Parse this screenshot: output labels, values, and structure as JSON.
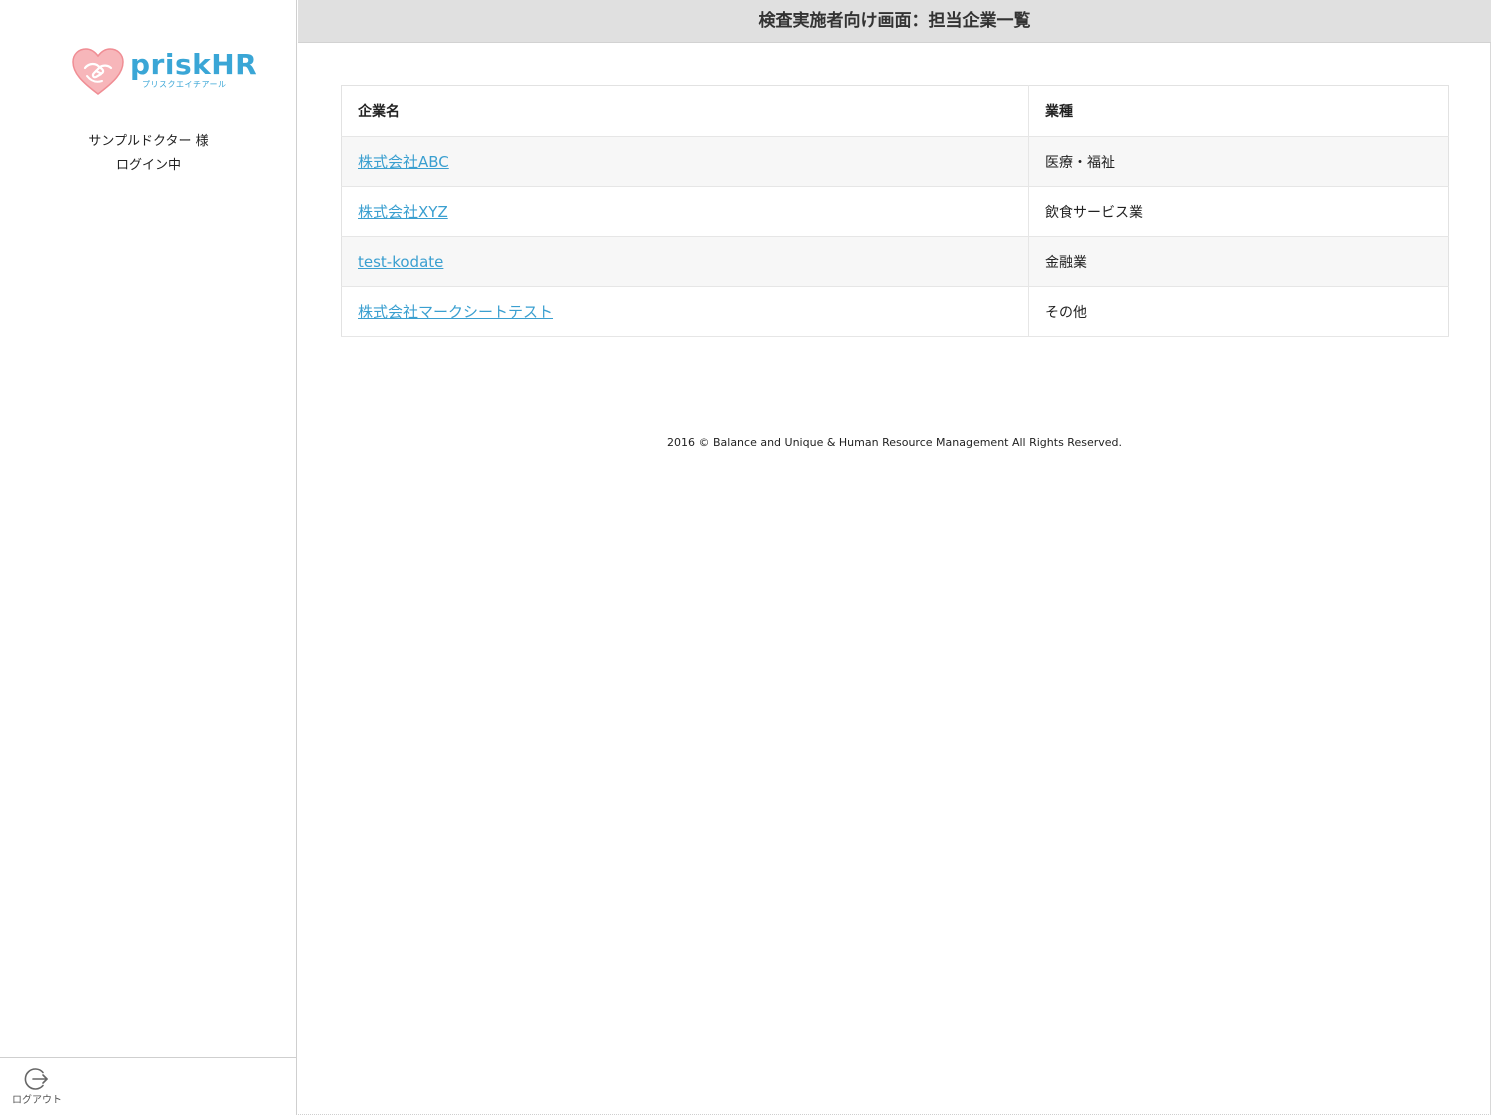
{
  "sidebar": {
    "logo": {
      "text": "priskHR",
      "subtext": "プリスクエイチアール"
    },
    "user": {
      "name": "サンプルドクター 様",
      "status": "ログイン中"
    },
    "logout_label": "ログアウト"
  },
  "header": {
    "title": "検査実施者向け画面：担当企業一覧"
  },
  "table": {
    "columns": [
      "企業名",
      "業種"
    ],
    "rows": [
      {
        "company": "株式会社ABC",
        "industry": "医療・福祉"
      },
      {
        "company": "株式会社XYZ",
        "industry": "飲食サービス業"
      },
      {
        "company": "test-kodate",
        "industry": "金融業"
      },
      {
        "company": "株式会社マークシートテスト",
        "industry": "その他"
      }
    ]
  },
  "footer": {
    "copyright": "2016 © Balance and Unique & Human Resource Management All Rights Reserved."
  },
  "colors": {
    "accent": "#3aa6d6",
    "link": "#3a9fd0",
    "header_bg": "#e0e0e0",
    "logo_heart": "#f4a3a8"
  },
  "icons": {
    "logo": "heart-hands-icon",
    "logout": "logout-icon"
  }
}
